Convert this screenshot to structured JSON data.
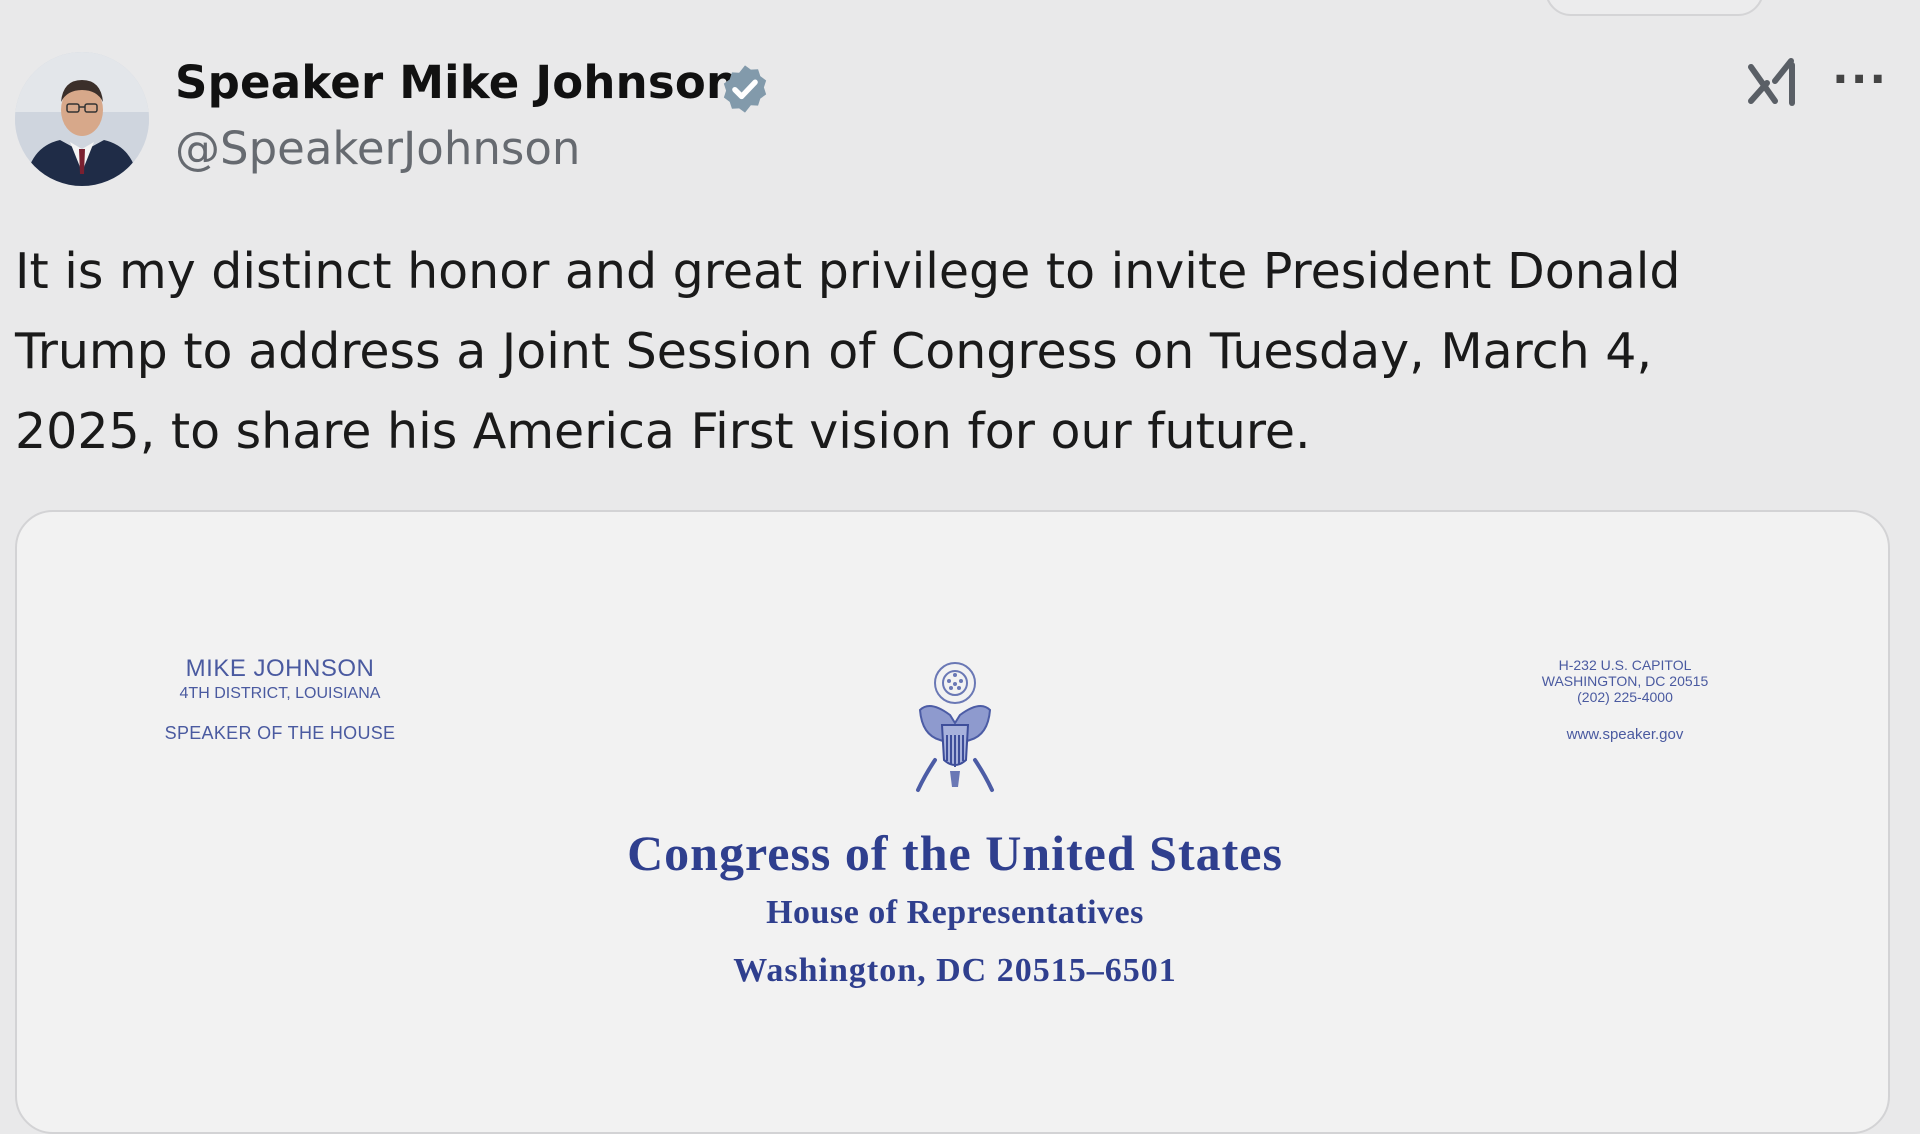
{
  "post": {
    "author": {
      "name": "Speaker Mike Johnson",
      "handle": "@SpeakerJohnson",
      "avatar_icon": "profile-photo",
      "verified_icon": "verified-badge-icon"
    },
    "actions": {
      "grok_icon": "x-ai-icon",
      "more_icon": "more-options-icon",
      "more_label": "···"
    },
    "text_lines": [
      "It is my distinct honor and great privilege to invite President Donald",
      "Trump to address a Joint Session of Congress on Tuesday, March 4,",
      "2025, to share his America First vision for our future."
    ]
  },
  "letterhead": {
    "left": {
      "name": "MIKE JOHNSON",
      "district": "4TH DISTRICT, LOUISIANA",
      "title": "SPEAKER OF THE HOUSE"
    },
    "right": {
      "address_lines": [
        "H-232 U.S. CAPITOL",
        "WASHINGTON, DC 20515",
        "(202) 225-4000"
      ],
      "website": "www.speaker.gov"
    },
    "seal_icon": "great-seal-eagle-icon",
    "center": {
      "line1": "Congress of the United States",
      "line2": "House of Representatives",
      "line3": "Washington, DC 20515–6501"
    }
  },
  "colors": {
    "background": "#e9e9ea",
    "letterhead_blue": "#2f3f8e",
    "verified_gray": "#829aab"
  }
}
